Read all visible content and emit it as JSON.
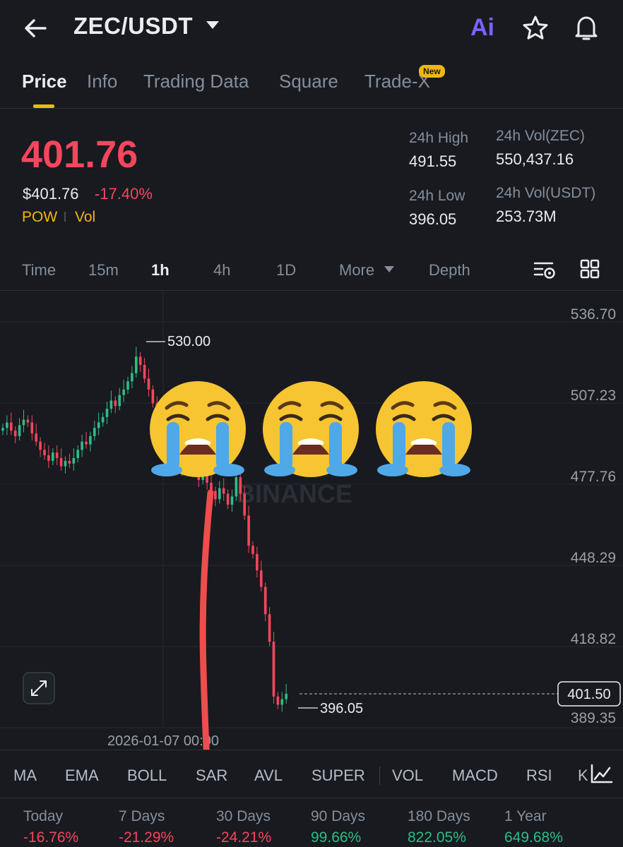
{
  "header": {
    "pair": "ZEC/USDT",
    "ai_label": "Ai"
  },
  "tabs": [
    {
      "label": "Price"
    },
    {
      "label": "Info"
    },
    {
      "label": "Trading Data"
    },
    {
      "label": "Square"
    },
    {
      "label": "Trade-X"
    }
  ],
  "badge_new": "New",
  "price": {
    "last": "401.76",
    "usd": "$401.76",
    "change": "-17.40%",
    "tags": [
      "POW",
      "Vol"
    ]
  },
  "stats": {
    "high_label": "24h High",
    "high_value": "491.55",
    "low_label": "24h Low",
    "low_value": "396.05",
    "vol_base_label": "24h Vol(ZEC)",
    "vol_base_value": "550,437.16",
    "vol_quote_label": "24h Vol(USDT)",
    "vol_quote_value": "253.73M"
  },
  "timeframes": [
    "Time",
    "15m",
    "1h",
    "4h",
    "1D",
    "More",
    "Depth"
  ],
  "active_timeframe": "1h",
  "chart": {
    "y_ticks": [
      "536.70",
      "507.23",
      "477.76",
      "448.29",
      "418.82",
      "389.35"
    ],
    "high_marker": "530.00",
    "low_marker": "396.05",
    "current_price_tag": "401.50",
    "x_tick": "2026-01-07 00:00",
    "watermark": "BINANCE",
    "up_color": "#2ebd85",
    "down_color": "#f6465d"
  },
  "indicators": [
    "MA",
    "EMA",
    "BOLL",
    "SAR",
    "AVL",
    "SUPER",
    "VOL",
    "MACD",
    "RSI",
    "K"
  ],
  "performance": [
    {
      "label": "Today",
      "value": "-16.76%",
      "color": "#f6465d"
    },
    {
      "label": "7 Days",
      "value": "-21.29%",
      "color": "#f6465d"
    },
    {
      "label": "30 Days",
      "value": "-24.21%",
      "color": "#f6465d"
    },
    {
      "label": "90 Days",
      "value": "99.66%",
      "color": "#2ebd85"
    },
    {
      "label": "180 Days",
      "value": "822.05%",
      "color": "#2ebd85"
    },
    {
      "label": "1 Year",
      "value": "649.68%",
      "color": "#2ebd85"
    }
  ]
}
